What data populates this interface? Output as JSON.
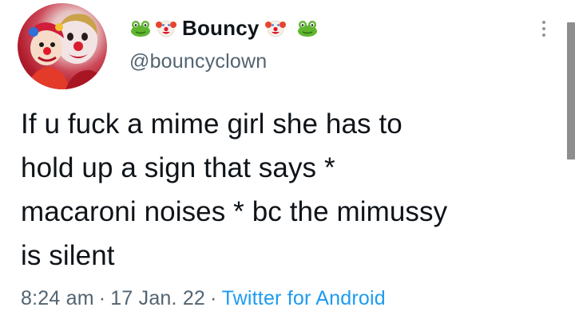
{
  "author": {
    "display_name": "Bouncy",
    "handle": "@bouncyclown",
    "avatar_icon": "clown-avatar",
    "name_decorations": [
      "frog-icon",
      "clown-face-icon",
      "clown-face-icon",
      "frog-icon"
    ]
  },
  "tweet": {
    "lines": [
      "If u fuck a mime girl she has to",
      "hold up a sign that says *",
      "macaroni noises * bc the mimussy",
      "is silent"
    ],
    "time": "8:24 am",
    "separator": "·",
    "date": "17 Jan. 22",
    "source": "Twitter for Android"
  },
  "colors": {
    "text": "#0f1419",
    "secondary": "#536471",
    "link": "#1d9bf0",
    "background": "#ffffff"
  },
  "menu": {
    "more_icon": "more-vertical-icon"
  }
}
